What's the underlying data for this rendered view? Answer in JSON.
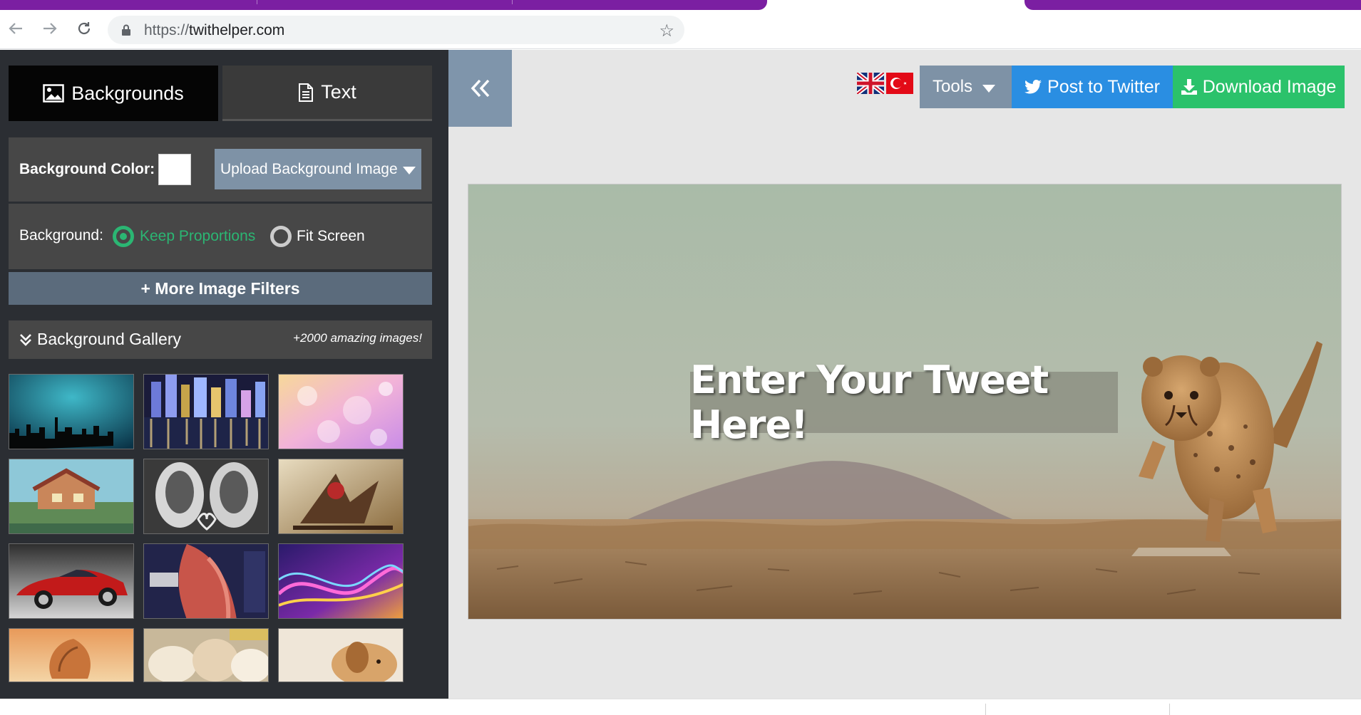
{
  "browser": {
    "url_scheme": "https://",
    "url_host": "twithelper.com",
    "icons": {
      "back": "arrow-left-icon",
      "forward": "arrow-right-icon",
      "reload": "reload-icon",
      "lock": "lock-icon",
      "bookmark": "star-icon"
    }
  },
  "sidebar": {
    "tabs": [
      {
        "label": "Backgrounds",
        "icon": "image-icon",
        "active": true
      },
      {
        "label": "Text",
        "icon": "document-icon",
        "active": false
      }
    ],
    "background_color_label": "Background Color:",
    "background_color_value": "#ffffff",
    "upload_label": "Upload Background Image",
    "background_label": "Background:",
    "options": [
      {
        "label": "Keep Proportions",
        "selected": true
      },
      {
        "label": "Fit Screen",
        "selected": false
      }
    ],
    "filters_label": "+ More Image Filters",
    "gallery_title": "Background Gallery",
    "gallery_note": "+2000 amazing images!",
    "gallery_thumbs": [
      "night-skyline",
      "city-lights",
      "pink-bokeh",
      "anime-house",
      "sneakers-heart",
      "fantasy-ship",
      "red-sports-car",
      "anime-warrior",
      "purple-waves",
      "sea-shell",
      "cats",
      "puppy"
    ]
  },
  "main": {
    "collapse_icon": "double-chevron-left-icon",
    "flags": [
      "uk-flag-icon",
      "turkey-flag-icon"
    ],
    "tools_label": "Tools",
    "twitter_label": "Post to Twitter",
    "download_label": "Download Image",
    "tweet_text": "Enter Your Tweet Here!",
    "colors": {
      "twitter": "#2a8ee2",
      "download": "#2bc26b",
      "tools": "#7e92a6",
      "radio_active": "#2bb673"
    }
  }
}
